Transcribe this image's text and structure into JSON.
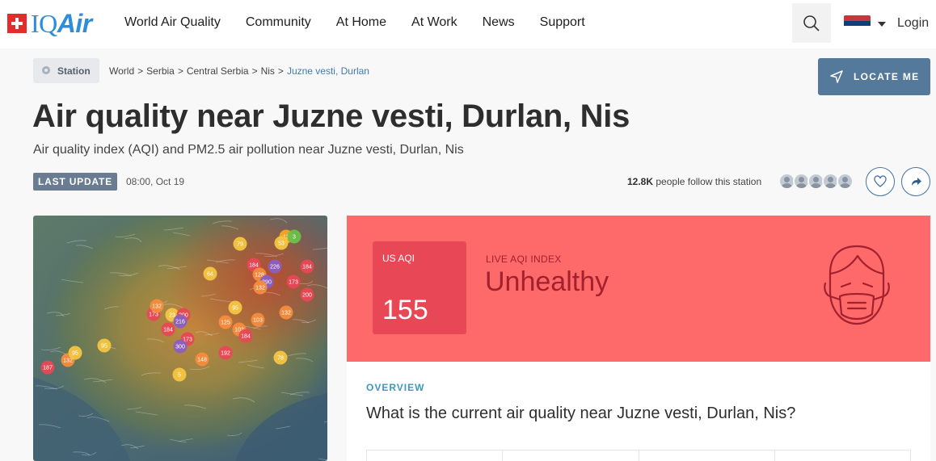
{
  "nav": {
    "logo_iq": "IQ",
    "logo_air": "Air",
    "links": [
      "World Air Quality",
      "Community",
      "At Home",
      "At Work",
      "News",
      "Support"
    ],
    "search_icon": "search-icon",
    "language_flag": "serbia-flag",
    "login": "Login"
  },
  "breadcrumb": {
    "chip_label": "Station",
    "items": [
      "World",
      "Serbia",
      "Central Serbia",
      "Nis"
    ],
    "current": "Juzne vesti, Durlan",
    "separator": ">"
  },
  "locate_button": "LOCATE ME",
  "page": {
    "title": "Air quality near Juzne vesti, Durlan, Nis",
    "subtitle": "Air quality index (AQI) and PM2.5 air pollution near Juzne vesti, Durlan, Nis",
    "last_update_label": "LAST UPDATE",
    "last_update_time": "08:00, Oct 19",
    "followers_count": "12.8K",
    "followers_text": "people follow this station"
  },
  "map": {
    "markers": [
      {
        "v": "13",
        "c": "#f5a623"
      },
      {
        "v": "3",
        "c": "#6cc04a"
      },
      {
        "v": "79",
        "c": "#f5c542"
      },
      {
        "v": "53",
        "c": "#f5c542"
      },
      {
        "v": "184",
        "c": "#e84855"
      },
      {
        "v": "226",
        "c": "#8b5fbf"
      },
      {
        "v": "184",
        "c": "#e84855"
      },
      {
        "v": "64",
        "c": "#f5c542"
      },
      {
        "v": "128",
        "c": "#f58c3d"
      },
      {
        "v": "290",
        "c": "#8b5fbf"
      },
      {
        "v": "132",
        "c": "#f58c3d"
      },
      {
        "v": "173",
        "c": "#e84855"
      },
      {
        "v": "200",
        "c": "#e84855"
      },
      {
        "v": "132",
        "c": "#f58c3d"
      },
      {
        "v": "173",
        "c": "#e84855"
      },
      {
        "v": "23",
        "c": "#f5c542"
      },
      {
        "v": "200",
        "c": "#e84855"
      },
      {
        "v": "216",
        "c": "#8b5fbf"
      },
      {
        "v": "184",
        "c": "#e84855"
      },
      {
        "v": "173",
        "c": "#e84855"
      },
      {
        "v": "300",
        "c": "#8b5fbf"
      },
      {
        "v": "95",
        "c": "#f5c542"
      },
      {
        "v": "125",
        "c": "#f58c3d"
      },
      {
        "v": "103",
        "c": "#f58c3d"
      },
      {
        "v": "103",
        "c": "#f58c3d"
      },
      {
        "v": "184",
        "c": "#e84855"
      },
      {
        "v": "132",
        "c": "#f58c3d"
      },
      {
        "v": "95",
        "c": "#f5c542"
      },
      {
        "v": "132",
        "c": "#f58c3d"
      },
      {
        "v": "148",
        "c": "#f58c3d"
      },
      {
        "v": "192",
        "c": "#e84855"
      },
      {
        "v": "78",
        "c": "#f5c542"
      },
      {
        "v": "187",
        "c": "#e84855"
      },
      {
        "v": "5",
        "c": "#f5c542"
      },
      {
        "v": "95",
        "c": "#f5c542"
      }
    ]
  },
  "aqi": {
    "label": "US AQI",
    "value": "155",
    "live_label": "LIVE AQI INDEX",
    "status": "Unhealthy",
    "card_color": "#fe6a69",
    "box_color": "#e84855",
    "text_color": "#a3202e",
    "icon": "face-mask-icon"
  },
  "overview": {
    "label": "OVERVIEW",
    "question": "What is the current air quality near Juzne vesti, Durlan, Nis?"
  }
}
